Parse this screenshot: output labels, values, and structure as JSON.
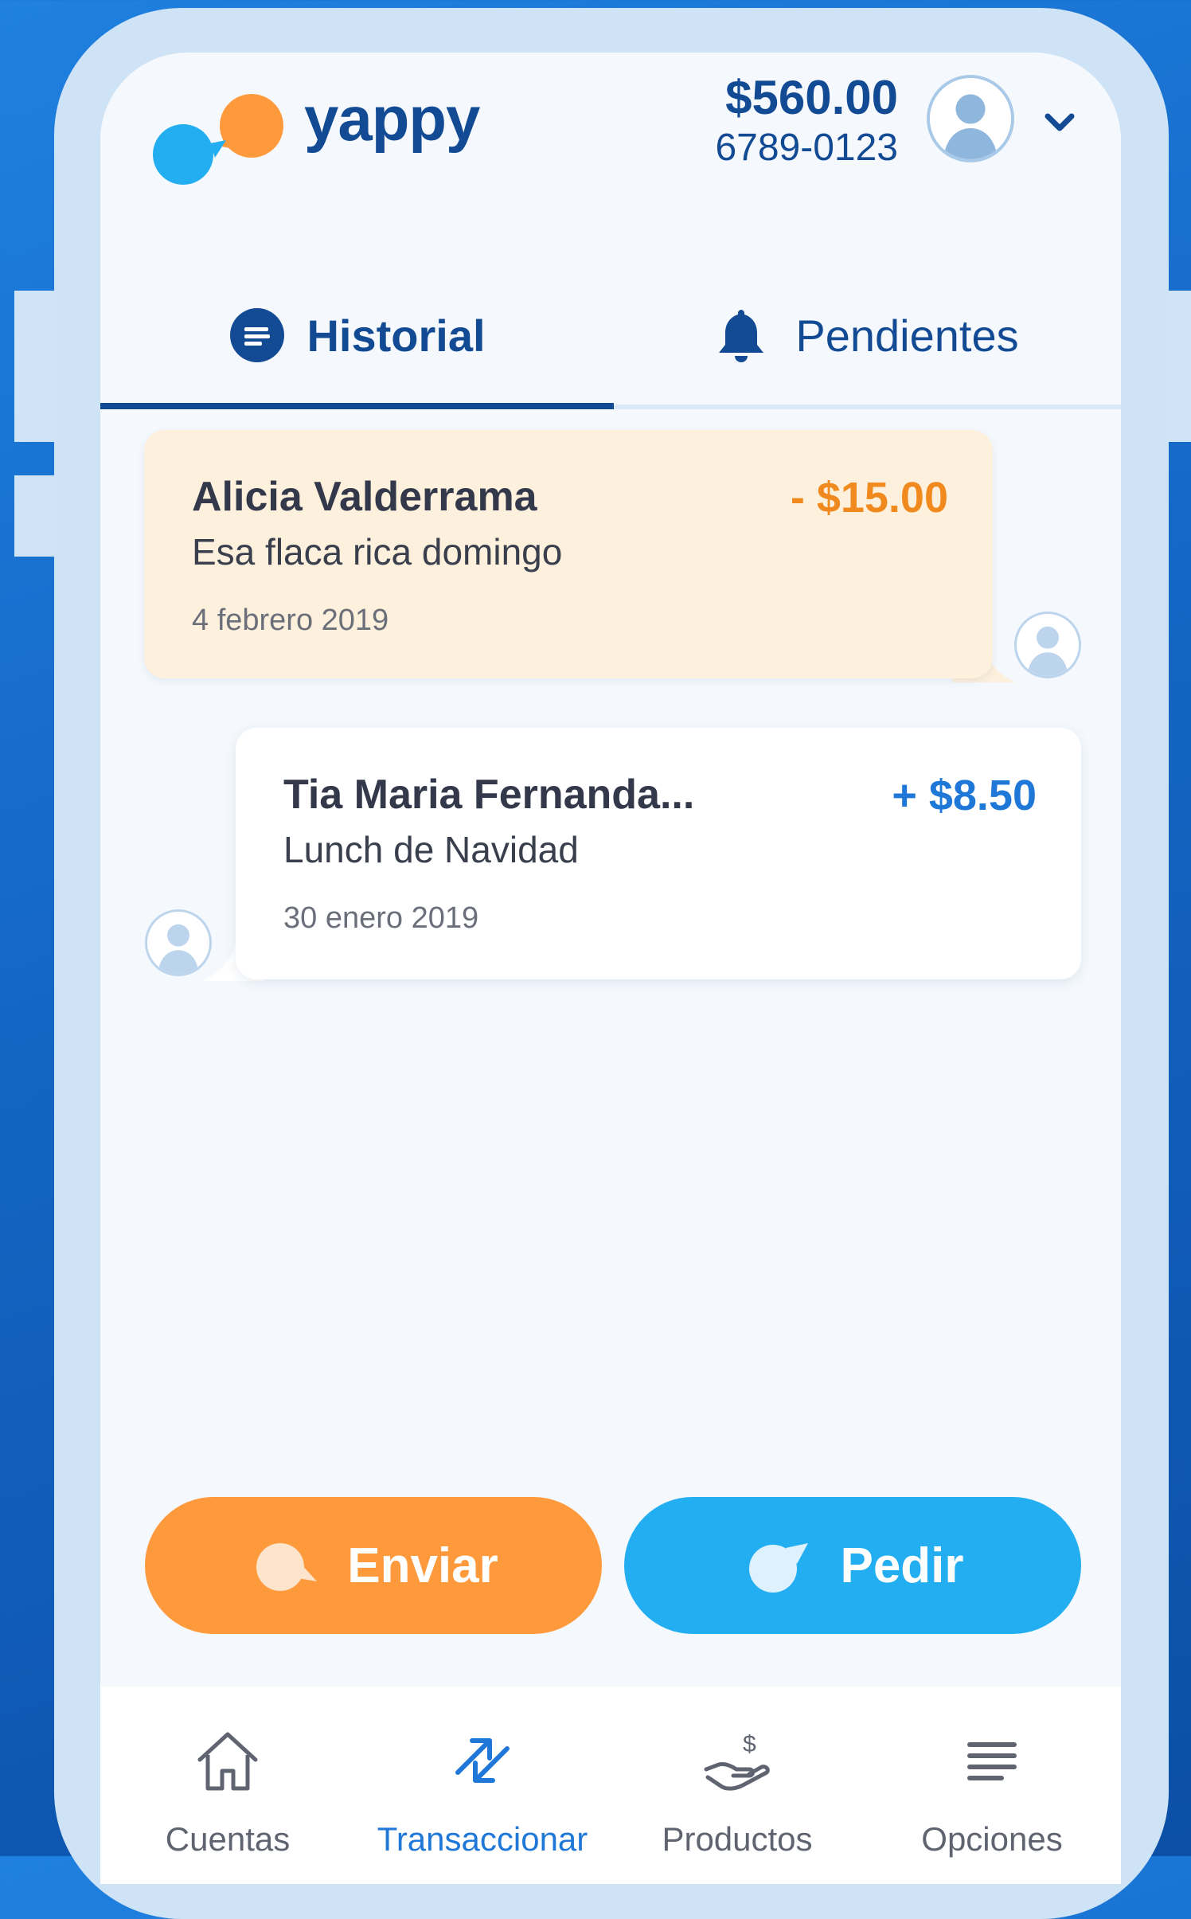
{
  "header": {
    "brand": "yappy",
    "balance": "$560.00",
    "phone_number": "6789-0123"
  },
  "tabs": [
    {
      "label": "Historial",
      "active": true,
      "icon": "list-circle-icon"
    },
    {
      "label": "Pendientes",
      "active": false,
      "icon": "bell-icon"
    }
  ],
  "transactions": [
    {
      "name": "Alicia Valderrama",
      "amount": "- $15.00",
      "description": "Esa flaca rica domingo",
      "date": "4 febrero 2019",
      "direction": "sent"
    },
    {
      "name": "Tia Maria Fernanda...",
      "amount": "+ $8.50",
      "description": "Lunch de Navidad",
      "date": "30 enero 2019",
      "direction": "received"
    }
  ],
  "actions": {
    "send_label": "Enviar",
    "request_label": "Pedir"
  },
  "bottom_nav": [
    {
      "label": "Cuentas",
      "icon": "home-icon",
      "active": false
    },
    {
      "label": "Transaccionar",
      "icon": "transfer-arrows-icon",
      "active": true
    },
    {
      "label": "Productos",
      "icon": "hand-money-icon",
      "active": false
    },
    {
      "label": "Opciones",
      "icon": "menu-lines-icon",
      "active": false
    }
  ],
  "colors": {
    "brand_dark": "#124a94",
    "send_orange": "#ff9a3c",
    "request_blue": "#22aef0",
    "negative_amount": "#f08a1e",
    "positive_amount": "#1f78d8",
    "sent_card_bg": "#fdf0dc"
  }
}
